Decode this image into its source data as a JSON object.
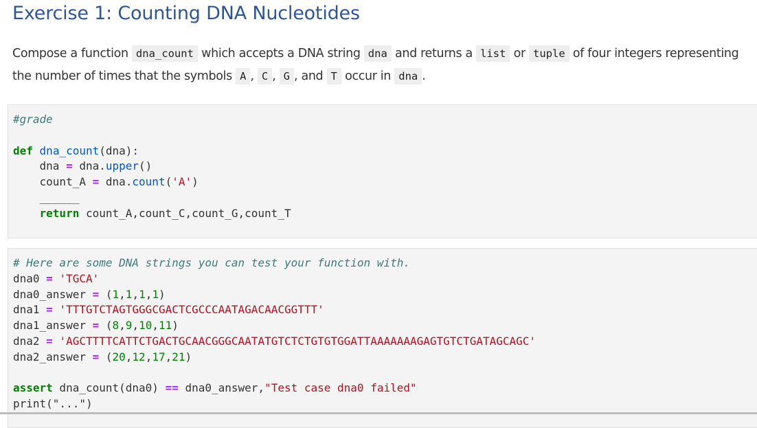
{
  "title": "Exercise 1: Counting DNA Nucleotides",
  "description": {
    "t1": "Compose a function ",
    "c1": "dna_count",
    "t2": " which accepts a DNA string ",
    "c2": "dna",
    "t3": " and returns a ",
    "c3": "list",
    "t4": " or ",
    "c4": "tuple",
    "t5": " of four integers representing the number of times that the symbols ",
    "c5": "A",
    "t6": ", ",
    "c6": "C",
    "t7": ", ",
    "c7": "G",
    "t8": ", and ",
    "c8": "T",
    "t9": " occur in ",
    "c9": "dna",
    "t10": "."
  },
  "cell1": {
    "comment": "#grade",
    "def_kw": "def",
    "func_name": "dna_count",
    "params": "(dna):",
    "line_upper": {
      "lhs": "    dna ",
      "op": "=",
      "mid": " dna.",
      "method": "upper",
      "tail": "()"
    },
    "line_count": {
      "lhs": "    count_A ",
      "op": "=",
      "mid": " dna.",
      "method": "count",
      "open": "(",
      "str": "'A'",
      "close": ")"
    },
    "blank_placeholder": "    ______",
    "return_kw": "    return",
    "return_vals": " count_A,count_C,count_G,count_T"
  },
  "cell2": {
    "comment": "# Here are some DNA strings you can test your function with.",
    "vars": [
      {
        "name": "dna0",
        "value": "'TGCA'",
        "answer_name": "dna0_answer",
        "answer": [
          "1",
          "1",
          "1",
          "1"
        ]
      },
      {
        "name": "dna1",
        "value": "'TTTGTCTAGTGGGCGACTCGCCCAATAGACAACGGTTT'",
        "answer_name": "dna1_answer",
        "answer": [
          "8",
          "9",
          "10",
          "11"
        ]
      },
      {
        "name": "dna2",
        "value": "'AGCTTTTCATTCTGACTGCAACGGGCAATATGTCTCTGTGTGGATTAAAAAAAGAGTGTCTGATAGCAGC'",
        "answer_name": "dna2_answer",
        "answer": [
          "20",
          "12",
          "17",
          "21"
        ]
      }
    ],
    "assert_kw": "assert",
    "assert_call": " dna_count(dna0) ",
    "assert_op": "==",
    "assert_rhs": " dna0_answer,",
    "assert_msg": "\"Test case dna0 failed\"",
    "partial_line": "print(\"...\")"
  },
  "colors": {
    "title": "#2f5597",
    "keyword": "#008000",
    "function": "#0055cc",
    "string": "#b3111f",
    "number": "#008000",
    "operator": "#aa22ff",
    "comment": "#3d7b7b",
    "cell_bg": "#f4f4f4"
  }
}
